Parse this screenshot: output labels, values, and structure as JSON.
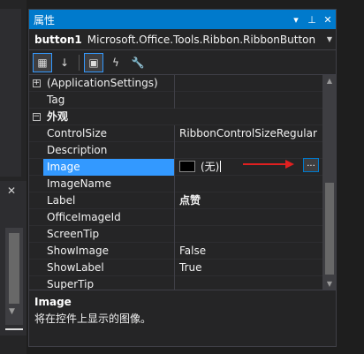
{
  "window": {
    "title": "属性",
    "buttons": {
      "dropdown": "▾",
      "pin": "⊥",
      "close": "✕"
    }
  },
  "object": {
    "name": "button1",
    "type": "Microsoft.Office.Tools.Ribbon.RibbonButton"
  },
  "toolbar": {
    "items": [
      {
        "icon": "categorized-icon",
        "glyph": "▦",
        "active": true
      },
      {
        "icon": "alphabetical-icon",
        "glyph": "↓",
        "active": false
      },
      {
        "icon": "properties-icon",
        "glyph": "▣",
        "active": true
      },
      {
        "icon": "events-icon",
        "glyph": "ϟ",
        "active": false
      },
      {
        "icon": "property-pages-icon",
        "glyph": "🔧",
        "active": false
      }
    ]
  },
  "grid": {
    "rows": [
      {
        "kind": "group",
        "expander": "+",
        "name": "(ApplicationSettings)",
        "value": ""
      },
      {
        "kind": "prop",
        "name": "Tag",
        "value": ""
      },
      {
        "kind": "cat",
        "expander": "−",
        "name": "外观",
        "value": ""
      },
      {
        "kind": "prop",
        "name": "ControlSize",
        "value": "RibbonControlSizeRegular"
      },
      {
        "kind": "prop",
        "name": "Description",
        "value": ""
      },
      {
        "kind": "selected",
        "name": "Image",
        "value": "(无)"
      },
      {
        "kind": "prop",
        "name": "ImageName",
        "value": ""
      },
      {
        "kind": "prop",
        "name": "Label",
        "value": "点赞",
        "bold": true
      },
      {
        "kind": "prop",
        "name": "OfficeImageId",
        "value": ""
      },
      {
        "kind": "prop",
        "name": "ScreenTip",
        "value": ""
      },
      {
        "kind": "prop",
        "name": "ShowImage",
        "value": "False"
      },
      {
        "kind": "prop",
        "name": "ShowLabel",
        "value": "True"
      },
      {
        "kind": "prop",
        "name": "SuperTip",
        "value": ""
      }
    ],
    "ellipsis_label": "..."
  },
  "description": {
    "title": "Image",
    "text": "将在控件上显示的图像。"
  },
  "colors": {
    "accent": "#007acc",
    "selection": "#3399ff",
    "arrow": "#e02020"
  }
}
